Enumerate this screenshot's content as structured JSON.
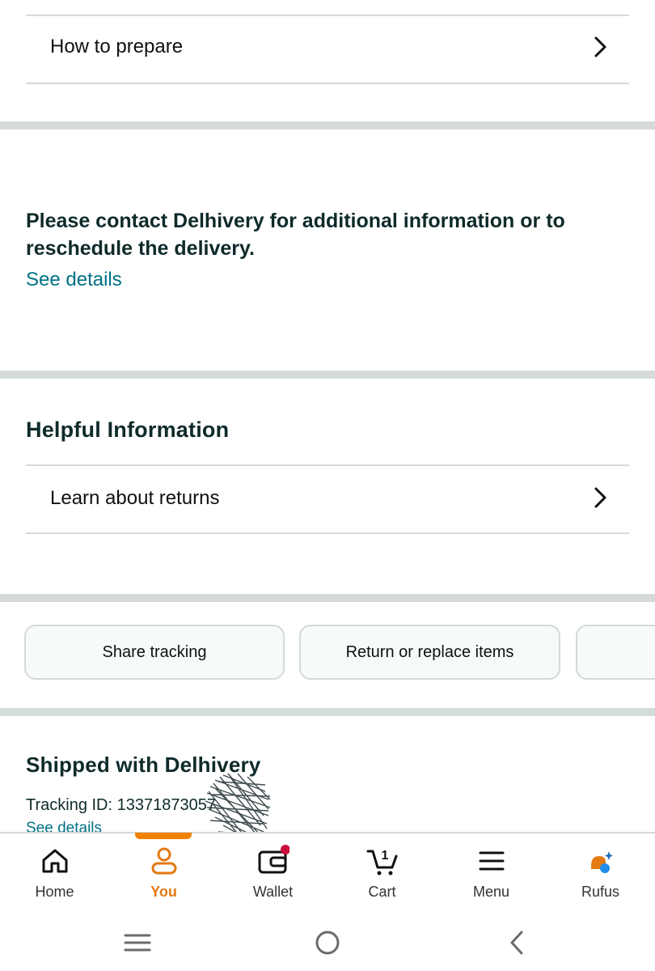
{
  "prepare_row": {
    "label": "How to prepare"
  },
  "delivery_alert": {
    "message": "Please contact Delhivery for additional information or to reschedule the delivery.",
    "link": "See details"
  },
  "helpful": {
    "title": "Helpful Information",
    "returns_row": "Learn about returns"
  },
  "actions": {
    "share": "Share tracking",
    "return": "Return or replace items"
  },
  "shipment": {
    "title": "Shipped with Delhivery",
    "tracking": "Tracking ID: 13371873057",
    "link": "See details"
  },
  "nav": {
    "home": "Home",
    "you": "You",
    "wallet": "Wallet",
    "cart": "Cart",
    "cart_count": "1",
    "menu": "Menu",
    "rufus": "Rufus"
  },
  "colors": {
    "accent": "#e47911",
    "link": "#007185",
    "title": "#0f2a2a",
    "divider": "#d5d9d9",
    "badge": "#cc0c39"
  },
  "icons": [
    "chevron-right-icon",
    "home-icon",
    "person-icon",
    "wallet-icon",
    "cart-icon",
    "menu-icon",
    "rufus-icon",
    "recents-icon",
    "home-circle-icon",
    "back-icon"
  ]
}
